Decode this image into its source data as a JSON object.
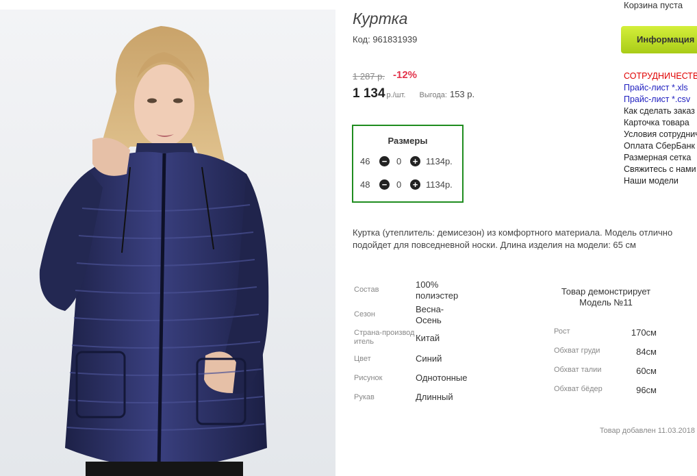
{
  "product": {
    "title": "Куртка",
    "code": "Код: 961831939",
    "old_price": "1 287 р.",
    "discount": "-12%",
    "price": "1 134",
    "price_unit": "р./шт.",
    "benefit_label": "Выгода:",
    "benefit_value": "153 р."
  },
  "sizes": {
    "title": "Размеры",
    "rows": [
      {
        "size": "46",
        "minus": "−",
        "qty": "0",
        "plus": "+",
        "price": "1134р."
      },
      {
        "size": "48",
        "minus": "−",
        "qty": "0",
        "plus": "+",
        "price": "1134р."
      }
    ]
  },
  "description": "Куртка (утеплитель: демисезон) из комфортного материала. Модель отлично подойдет для повседневной носки. Длина изделия на модели: 65 см",
  "properties": [
    {
      "key": "Состав",
      "value": "100% полиэстер"
    },
    {
      "key": "Сезон",
      "value": "Весна-Осень"
    },
    {
      "key": "Страна-производитель",
      "value": "Китай"
    },
    {
      "key": "Цвет",
      "value": "Синий"
    },
    {
      "key": "Рисунок",
      "value": "Однотонные"
    },
    {
      "key": "Рукав",
      "value": "Длинный"
    }
  ],
  "model": {
    "title": "Товар демонстрирует Модель №11",
    "params": [
      {
        "key": "Рост",
        "value": "170см"
      },
      {
        "key": "Обхват груди",
        "value": "84см"
      },
      {
        "key": "Обхват талии",
        "value": "60см"
      },
      {
        "key": "Обхват бёдер",
        "value": "96см"
      }
    ]
  },
  "added": "Товар добавлен 11.03.2018",
  "sidebar": {
    "cart_status": "Корзина пуста",
    "info_button": "Информация",
    "items": [
      {
        "label": "СОТРУДНИЧЕСТВО",
        "kind": "heading"
      },
      {
        "label": "Прайс-лист *.xls",
        "kind": "link"
      },
      {
        "label": "Прайс-лист *.csv",
        "kind": "link"
      },
      {
        "label": "Как сделать заказ",
        "kind": "item"
      },
      {
        "label": "Карточка товара",
        "kind": "item"
      },
      {
        "label": "Условия сотрудничества",
        "kind": "item"
      },
      {
        "label": "Оплата СберБанк",
        "kind": "item"
      },
      {
        "label": "Размерная сетка",
        "kind": "item"
      },
      {
        "label": "Свяжитесь с нами",
        "kind": "item"
      },
      {
        "label": "Наши модели",
        "kind": "item"
      }
    ]
  },
  "colors": {
    "discount": "#e2324a",
    "sizes_border": "#1f8c1f",
    "info_button": "#c2e22c",
    "sidebar_heading": "#e00000",
    "sidebar_link": "#1d1dbf",
    "jacket": "#252a55"
  }
}
